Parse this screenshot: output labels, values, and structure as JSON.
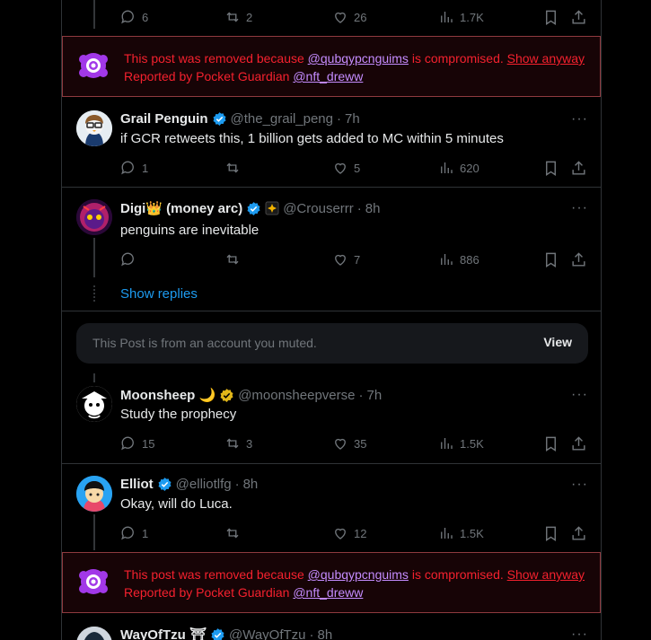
{
  "top_actions": {
    "replies": "6",
    "reposts": "2",
    "likes": "26",
    "views": "1.7K"
  },
  "removed_notice": {
    "prefix": "This post was removed because",
    "handle": "@qubqypcnguims",
    "suffix": "is compromised.",
    "show_anyway": "Show anyway",
    "reported_by": "Reported by Pocket Guardian",
    "reporter_handle": "@nft_dreww"
  },
  "posts": [
    {
      "name": "Grail Penguin",
      "handle": "@the_grail_peng",
      "sep": "·",
      "time": "7h",
      "text": "if GCR retweets this, 1 billion gets added to MC within 5 minutes",
      "replies": "1",
      "reposts": "",
      "likes": "5",
      "views": "620"
    },
    {
      "name": "Digi👑 (money arc)",
      "handle": "@Crouserrr",
      "sep": "·",
      "time": "8h",
      "text": "penguins are inevitable",
      "replies": "",
      "reposts": "",
      "likes": "7",
      "views": "886",
      "show_replies": "Show replies"
    },
    {
      "name": "Moonsheep 🌙",
      "handle": "@moonsheepverse",
      "sep": "·",
      "time": "7h",
      "text": "Study the prophecy",
      "replies": "15",
      "reposts": "3",
      "likes": "35",
      "views": "1.5K"
    },
    {
      "name": "Elliot",
      "handle": "@elliotlfg",
      "sep": "·",
      "time": "8h",
      "text": "Okay, will do Luca.",
      "replies": "1",
      "reposts": "",
      "likes": "12",
      "views": "1.5K"
    },
    {
      "name": "WayOfTzu ⛩",
      "handle": "@WayOfTzu",
      "sep": "·",
      "time": "8h"
    }
  ],
  "muted": {
    "text": "This Post is from an account you muted.",
    "view_label": "View"
  },
  "more_label": "···",
  "colors": {
    "accent": "#1d9bf0",
    "verified_blue": "#1d9bf0",
    "verified_gold": "#e2b719",
    "removed_text": "#f4212e",
    "removed_link": "#c58cff"
  }
}
